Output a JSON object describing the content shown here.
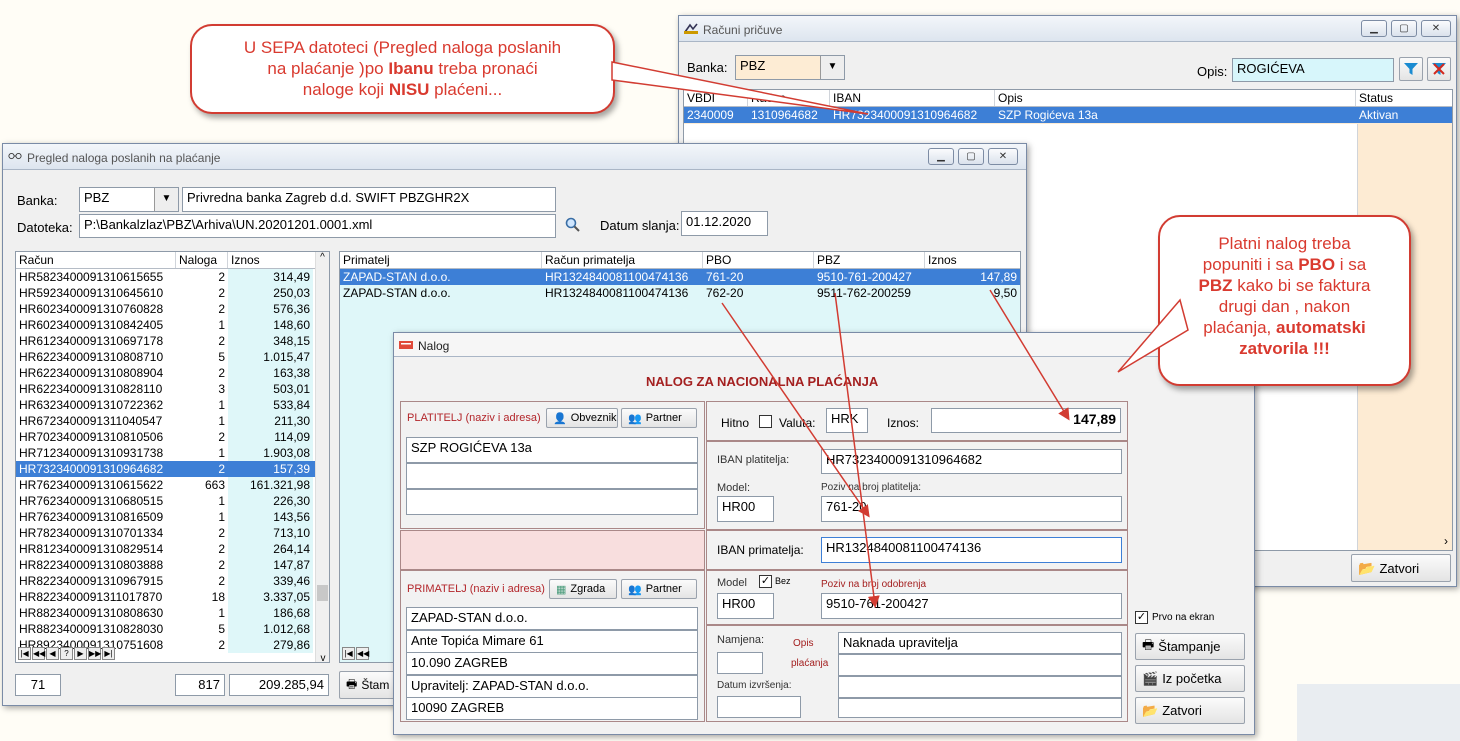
{
  "callout_top": {
    "line1": "U SEPA datoteci (Pregled naloga poslanih",
    "line2": "na plaćanje )po ",
    "bold1": "Ibanu",
    "line2b": " treba pronaći",
    "line3": "naloge koji ",
    "bold2": "NISU",
    "line3b": " plaćeni..."
  },
  "callout_right": {
    "l1": "Platni nalog treba",
    "l2a": "popuniti i sa ",
    "b1": "PBO",
    "l2b": " i sa",
    "b2": "PBZ",
    "l3b": " kako bi se faktura",
    "l4": "drugi dan , nakon",
    "l5": "plaćanja, ",
    "b3": "automatski",
    "b4": "zatvorila !!!"
  },
  "racuni": {
    "title": "Računi pričuve",
    "banka_label": "Banka:",
    "banka_value": "PBZ",
    "opis_label": "Opis:",
    "opis_value": "ROGIĆEVA",
    "cols": [
      "VBDI",
      "Račun",
      "IBAN",
      "Opis",
      "Status"
    ],
    "row": {
      "vbdi": "2340009",
      "racun": "1310964682",
      "iban": "HR7323400091310964682",
      "opis": "SZP Rogićeva 13a",
      "status": "Aktivan"
    },
    "close_label": "Zatvori"
  },
  "pregled": {
    "title": "Pregled naloga poslanih na plaćanje",
    "banka_label": "Banka:",
    "banka_value": "PBZ",
    "banka_desc": "Privredna banka Zagreb d.d. SWIFT PBZGHR2X",
    "datoteka_label": "Datoteka:",
    "datoteka_value": "P:\\Bankalzlaz\\PBZ\\Arhiva\\UN.20201201.0001.xml",
    "datum_label": "Datum slanja:",
    "datum_value": "01.12.2020",
    "left_cols": [
      "Račun",
      "Naloga",
      "Iznos"
    ],
    "left_rows": [
      [
        "HR5823400091310615655",
        "2",
        "314,49"
      ],
      [
        "HR5923400091310645610",
        "2",
        "250,03"
      ],
      [
        "HR6023400091310760828",
        "2",
        "576,36"
      ],
      [
        "HR6023400091310842405",
        "1",
        "148,60"
      ],
      [
        "HR6123400091310697178",
        "2",
        "348,15"
      ],
      [
        "HR6223400091310808710",
        "5",
        "1.015,47"
      ],
      [
        "HR6223400091310808904",
        "2",
        "163,38"
      ],
      [
        "HR6223400091310828110",
        "3",
        "503,01"
      ],
      [
        "HR6323400091310722362",
        "1",
        "533,84"
      ],
      [
        "HR6723400091311040547",
        "1",
        "211,30"
      ],
      [
        "HR7023400091310810506",
        "2",
        "114,09"
      ],
      [
        "HR7123400091310931738",
        "1",
        "1.903,08"
      ],
      [
        "HR7323400091310964682",
        "2",
        "157,39"
      ],
      [
        "HR7623400091310615622",
        "663",
        "161.321,98"
      ],
      [
        "HR7623400091310680515",
        "1",
        "226,30"
      ],
      [
        "HR7623400091310816509",
        "1",
        "143,56"
      ],
      [
        "HR7823400091310701334",
        "2",
        "713,10"
      ],
      [
        "HR8123400091310829514",
        "2",
        "264,14"
      ],
      [
        "HR8223400091310803888",
        "2",
        "147,87"
      ],
      [
        "HR8223400091310967915",
        "2",
        "339,46"
      ],
      [
        "HR8223400091311017870",
        "18",
        "3.337,05"
      ],
      [
        "HR8823400091310808630",
        "1",
        "186,68"
      ],
      [
        "HR8823400091310828030",
        "5",
        "1.012,68"
      ],
      [
        "HR8923400091310751608",
        "2",
        "279,86"
      ]
    ],
    "selected_index": 12,
    "right_cols": [
      "Primatelj",
      "Račun primatelja",
      "PBO",
      "PBZ",
      "Iznos"
    ],
    "right_rows": [
      [
        "ZAPAD-STAN d.o.o.",
        "HR1324840081100474136",
        "761-20",
        "9510-761-200427",
        "147,89"
      ],
      [
        "ZAPAD-STAN d.o.o.",
        "HR1324840081100474136",
        "762-20",
        "9511-762-200259",
        "9,50"
      ]
    ],
    "total_count": "71",
    "total_naloga": "817",
    "total_iznos": "209.285,94",
    "stamp_label": "Štam"
  },
  "nalog": {
    "title": "Nalog",
    "heading": "NALOG ZA NACIONALNA PLAĆANJA",
    "platitelj_label": "PLATITELJ (naziv i adresa)",
    "obveznik_label": "Obveznik",
    "partner_label": "Partner",
    "platitelj_lines": [
      "SZP ROGIĆEVA 13a",
      "",
      ""
    ],
    "hitno_label": "Hitno",
    "valuta_label": "Valuta:",
    "valuta_value": "HRK",
    "iznos_label": "Iznos:",
    "iznos_value": "147,89",
    "iban_plat_label": "IBAN platitelja:",
    "iban_plat_value": "HR7323400091310964682",
    "model_label": "Model:",
    "model_plat": "HR00",
    "poziv_plat_label": "Poziv na broj platitelja:",
    "poziv_plat_value": "761-20",
    "iban_prim_label": "IBAN primatelja:",
    "iban_prim_value": "HR1324840081100474136",
    "primatelj_label": "PRIMATELJ (naziv i adresa)",
    "zgrada_label": "Zgrada",
    "partner2_label": "Partner",
    "model2_label": "Model",
    "bez_label": "Bez",
    "model_prim": "HR00",
    "poziv_prim_label": "Poziv na broj odobrenja",
    "poziv_prim_value": "9510-761-200427",
    "primatelj_lines": [
      "ZAPAD-STAN d.o.o.",
      "Ante Topića Mimare 61",
      "10.090 ZAGREB",
      "Upravitelj: ZAPAD-STAN d.o.o.",
      "10090 ZAGREB"
    ],
    "namjena_label": "Namjena:",
    "opis_label": "Opis",
    "placanja_label": "plaćanja",
    "opis_lines": [
      "Naknada upravitelja",
      "",
      ""
    ],
    "datum_izvr_label": "Datum izvršenja:",
    "prvo_label": "Prvo na ekran",
    "stampanje_label": "Štampanje",
    "izpocetka_label": "Iz početka",
    "zatvori_label": "Zatvori"
  },
  "colors": {
    "accent": "#3d7fd6",
    "callout_red": "#d93a2f",
    "cyan": "#dff7f9",
    "peach": "#fdebd3"
  }
}
